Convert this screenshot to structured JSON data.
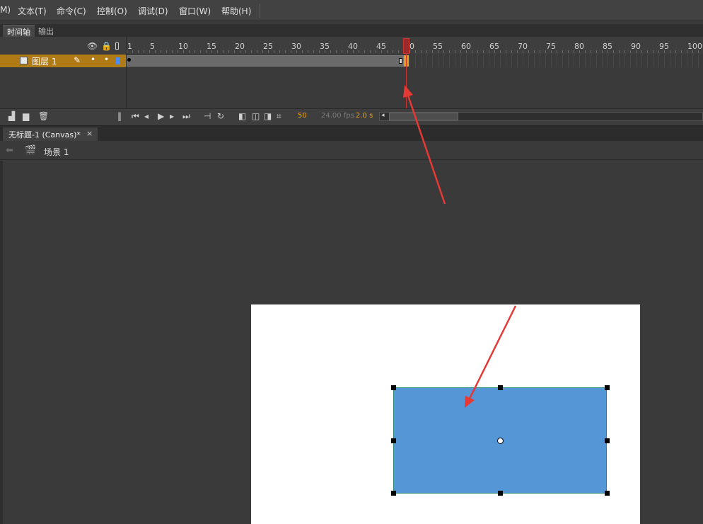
{
  "menu": {
    "items": [
      {
        "label": "M)"
      },
      {
        "label": "文本(T)"
      },
      {
        "label": "命令(C)"
      },
      {
        "label": "控制(O)"
      },
      {
        "label": "调试(D)"
      },
      {
        "label": "窗口(W)"
      },
      {
        "label": "帮助(H)"
      }
    ]
  },
  "timeline": {
    "tabs": [
      {
        "label": "时间轴",
        "active": true
      },
      {
        "label": "输出",
        "active": false
      }
    ],
    "ruler_numbers": [
      "1",
      "5",
      "10",
      "15",
      "20",
      "25",
      "30",
      "35",
      "40",
      "45",
      "50",
      "55",
      "60",
      "65",
      "70",
      "75",
      "80",
      "85",
      "90",
      "95",
      "100"
    ],
    "layer": {
      "name": "图层 1",
      "color": "#b07a14",
      "outline_color": "#4a8cff"
    },
    "current_frame": "50",
    "fps": "24.00 fps",
    "time": "2.0 s"
  },
  "document": {
    "tab_title": "无标题-1 (Canvas)*",
    "close_glyph": "×",
    "scene": "场景 1"
  },
  "stage": {
    "canvas_color": "#ffffff",
    "shape_fill": "#5596d6",
    "annotation_color": "#e53935"
  }
}
